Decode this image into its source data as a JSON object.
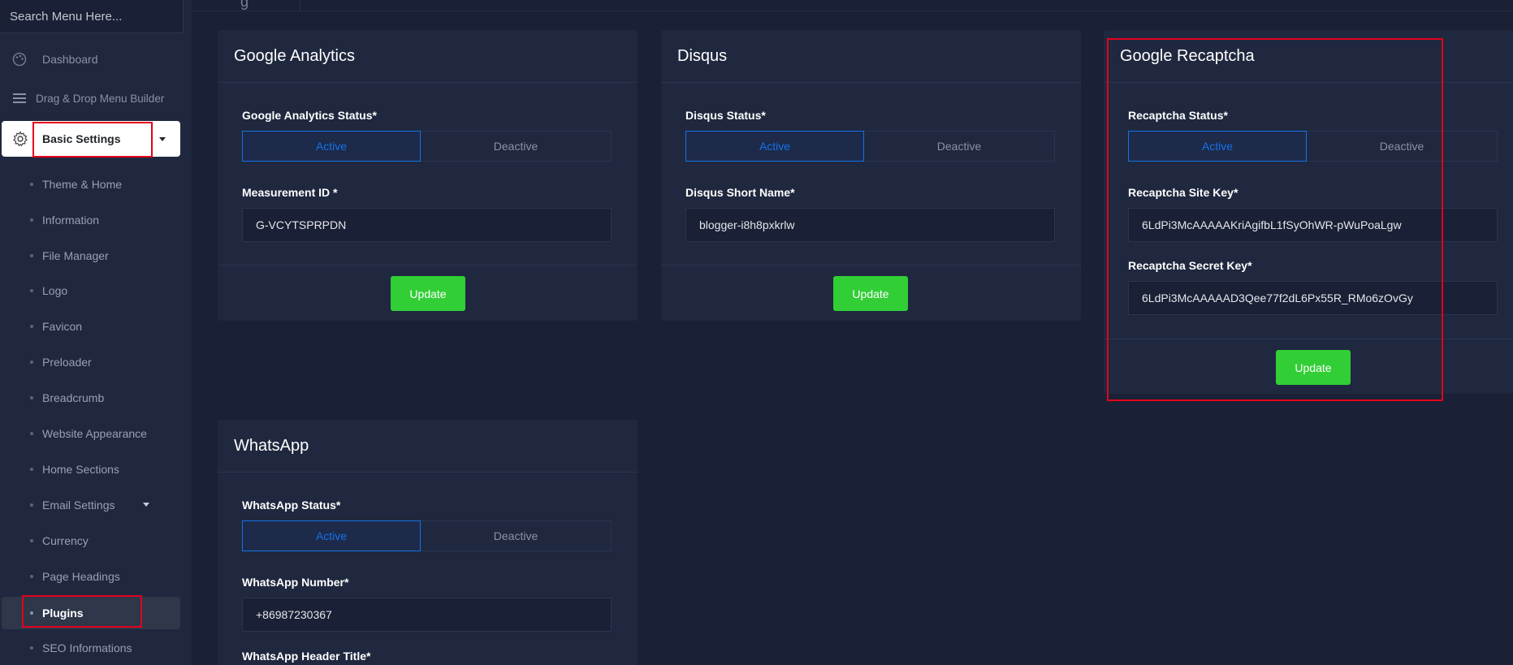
{
  "sidebar": {
    "search_placeholder": "Search Menu Here...",
    "dashboard": "Dashboard",
    "dnd_builder": "Drag & Drop Menu Builder",
    "basic_settings": "Basic Settings",
    "sub_items": [
      "Theme & Home",
      "Information",
      "File Manager",
      "Logo",
      "Favicon",
      "Preloader",
      "Breadcrumb",
      "Website Appearance",
      "Home Sections",
      "Email Settings",
      "Currency",
      "Page Headings",
      "Plugins",
      "SEO Informations"
    ],
    "active_item": "Plugins"
  },
  "cards": {
    "analytics": {
      "title": "Google Analytics",
      "status_label": "Google Analytics Status*",
      "active": "Active",
      "deactive": "Deactive",
      "measurement_label": "Measurement ID *",
      "measurement_value": "G-VCYTSPRPDN",
      "update": "Update"
    },
    "disqus": {
      "title": "Disqus",
      "status_label": "Disqus Status*",
      "active": "Active",
      "deactive": "Deactive",
      "shortname_label": "Disqus Short Name*",
      "shortname_value": "blogger-i8h8pxkrlw",
      "update": "Update"
    },
    "recaptcha": {
      "title": "Google Recaptcha",
      "status_label": "Recaptcha Status*",
      "active": "Active",
      "deactive": "Deactive",
      "site_key_label": "Recaptcha Site Key*",
      "site_key_value": "6LdPi3McAAAAAKriAgifbL1fSyOhWR-pWuPoaLgw",
      "secret_key_label": "Recaptcha Secret Key*",
      "secret_key_value": "6LdPi3McAAAAAD3Qee77f2dL6Px55R_RMo6zOvGy",
      "update": "Update"
    },
    "whatsapp": {
      "title": "WhatsApp",
      "status_label": "WhatsApp Status*",
      "active": "Active",
      "deactive": "Deactive",
      "number_label": "WhatsApp Number*",
      "number_value": "+86987230367",
      "header_title_label": "WhatsApp Header Title*"
    }
  },
  "colors": {
    "background": "#1a2035",
    "card": "#1f283e",
    "primary": "#1572e8",
    "success": "#31ce36",
    "highlight": "#e4001c"
  },
  "icons": {
    "dashboard": "palette-icon",
    "dnd": "bars-icon",
    "basic_settings": "gear-icon"
  }
}
